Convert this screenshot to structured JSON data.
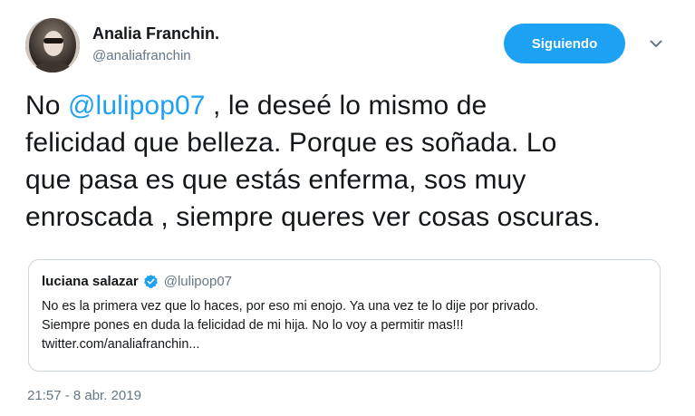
{
  "author": {
    "display_name": "Analia Franchin.",
    "handle": "@analiafranchin"
  },
  "actions": {
    "follow_label": "Siguiendo"
  },
  "tweet": {
    "text_lines": {
      "l1_before": "No ",
      "l1_mention": "@lulipop07",
      "l1_after": " , le deseé lo mismo de",
      "l2": "felicidad que belleza. Porque es soñada. Lo",
      "l3": "que pasa es que estás enferma, sos muy",
      "l4": "enroscada , siempre queres ver cosas oscuras."
    },
    "timestamp": "21:57 - 8 abr. 2019"
  },
  "quoted_tweet": {
    "display_name": "luciana salazar",
    "handle": "@lulipop07",
    "verified": true,
    "lines": {
      "l1": "No es la primera vez que lo haces, por eso mi enojo. Ya una vez te lo dije por privado.",
      "l2": "Siempre pones en duda la felicidad de mi hija. No lo voy a permitir mas!!!",
      "l3": "twitter.com/analiafranchin..."
    }
  },
  "colors": {
    "accent": "#1da1f2",
    "secondary_text": "#657786",
    "border": "#ccd6dd"
  },
  "icons": {
    "verified": "verified-badge-icon",
    "caret": "chevron-down-icon"
  }
}
